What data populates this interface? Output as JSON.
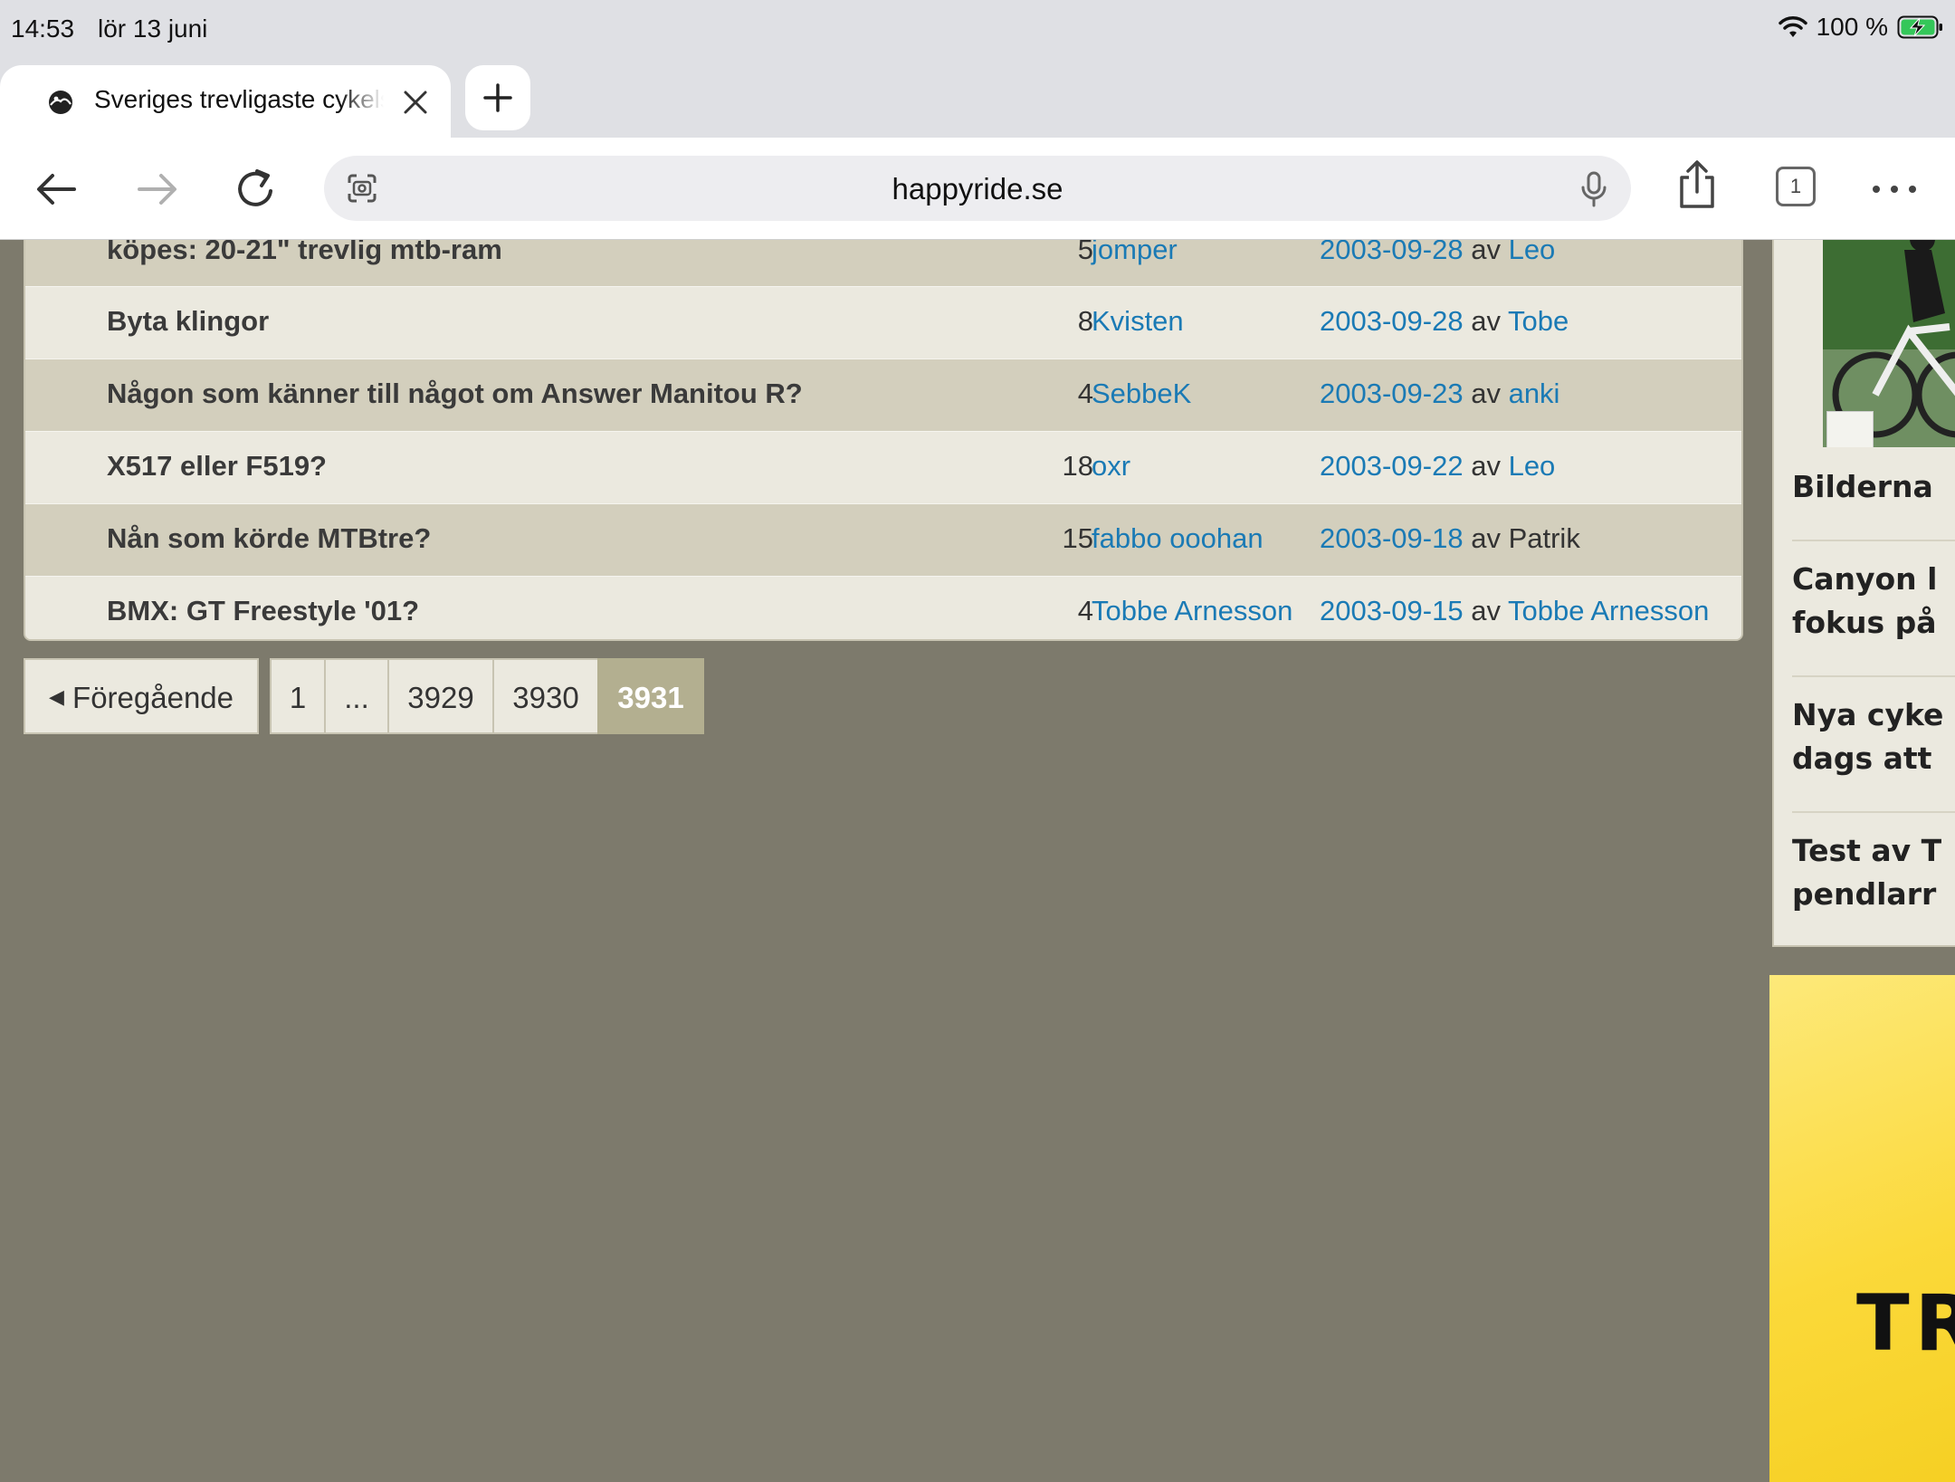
{
  "status_bar": {
    "time": "14:53",
    "date": "lör 13 juni",
    "battery": "100 %"
  },
  "browser": {
    "tab_title": "Sveriges trevligaste cykelsajt",
    "url": "happyride.se",
    "tab_count": "1"
  },
  "forum": {
    "rows": [
      {
        "title": "köpes: 20-21\" trevlig mtb-ram",
        "count": "5",
        "author": "jomper",
        "date": "2003-09-28",
        "av": "av",
        "last_by": "Leo"
      },
      {
        "title": "Byta klingor",
        "count": "8",
        "author": "Kvisten",
        "date": "2003-09-28",
        "av": "av",
        "last_by": "Tobe"
      },
      {
        "title": "Någon som känner till något om Answer Manitou R?",
        "count": "4",
        "author": "SebbeK",
        "date": "2003-09-23",
        "av": "av",
        "last_by": "anki"
      },
      {
        "title": "X517 eller F519?",
        "count": "18",
        "author": "oxr",
        "date": "2003-09-22",
        "av": "av",
        "last_by": "Leo"
      },
      {
        "title": "Nån som körde MTBtre?",
        "count": "15",
        "author": "fabbo ooohan",
        "date": "2003-09-18",
        "av": "av",
        "last_by": "Patrik"
      },
      {
        "title": "BMX: GT Freestyle '01?",
        "count": "4",
        "author": "Tobbe Arnesson",
        "date": "2003-09-15",
        "av": "av",
        "last_by": "Tobbe Arnesson"
      }
    ]
  },
  "pagination": {
    "prev_label": "Föregående",
    "pages": [
      "1",
      "...",
      "3929",
      "3930",
      "3931"
    ],
    "current": "3931"
  },
  "sidebar": {
    "items": [
      [
        "Bilderna"
      ],
      [
        "Canyon l",
        "fokus på"
      ],
      [
        "Nya cyke",
        "dags att"
      ],
      [
        "Test av T",
        "pendlarr"
      ]
    ]
  },
  "ad": {
    "text": "TR"
  },
  "colors": {
    "page_bg": "#7d7a6c",
    "link": "#1a7ab5",
    "row_dark": "#d3cfbd",
    "row_light": "#ebe9df",
    "current_page": "#b3af90"
  }
}
